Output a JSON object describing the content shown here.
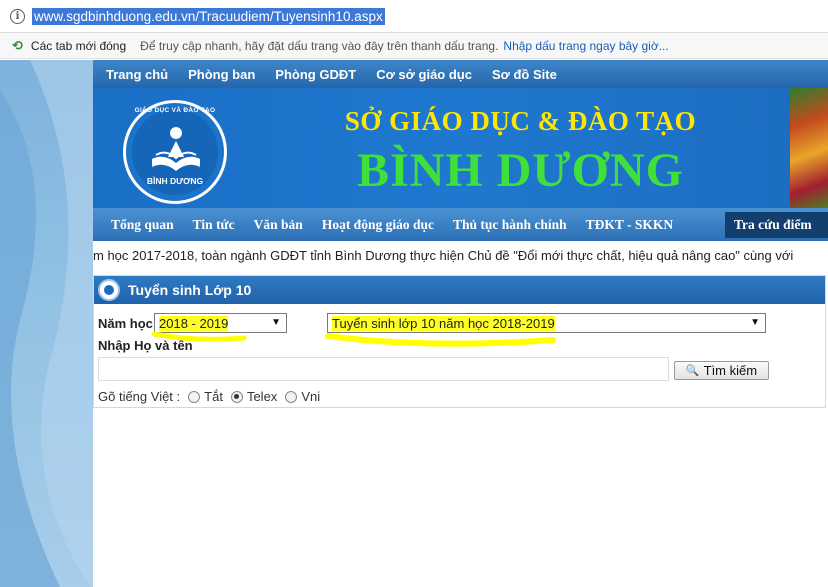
{
  "browser": {
    "url": "www.sgdbinhduong.edu.vn/Tracuudiem/Tuyensinh10.aspx",
    "bookmark_bar": {
      "recent_tabs": "Các tab mới đóng",
      "hint": "Để truy cập nhanh, hãy đặt dấu trang vào đây trên thanh dấu trang.",
      "link": "Nhập dấu trang ngay bây giờ..."
    }
  },
  "top_nav": [
    "Trang chủ",
    "Phòng ban",
    "Phòng GDĐT",
    "Cơ sở giáo dục",
    "Sơ đồ Site"
  ],
  "banner": {
    "logo_arc": "GIÁO DỤC VÀ ĐÀO TẠO",
    "logo_name": "BÌNH DƯƠNG",
    "title_line1": "SỞ GIÁO DỤC & ĐÀO TẠO",
    "title_line2": "BÌNH DƯƠNG"
  },
  "main_nav": {
    "items": [
      "Tổng quan",
      "Tin tức",
      "Văn bản",
      "Hoạt động giáo dục",
      "Thủ tục hành chính",
      "TĐKT - SKKN"
    ],
    "active": "Tra cứu điểm"
  },
  "ticker": "m học 2017-2018, toàn ngành GDĐT tỉnh Bình Dương thực hiện Chủ đề \"Đổi mới thực chất, hiệu quả nâng cao\" cùng với",
  "panel": {
    "title": "Tuyển sinh Lớp 10",
    "year_label": "Năm học",
    "year_value": "2018 - 2019",
    "exam_value": "Tuyển sinh lớp 10 năm học 2018-2019",
    "name_label": "Nhập Họ và tên",
    "name_value": "",
    "search_button": "Tìm kiếm",
    "typing_label": "Gõ tiếng Việt :",
    "typing_options": [
      "Tắt",
      "Telex",
      "Vni"
    ],
    "typing_selected": "Telex"
  },
  "colors": {
    "nav_blue": "#2c6fb6",
    "banner_blue": "#1a6fc6",
    "title_yellow": "#ffe600",
    "title_green": "#3fe03a",
    "highlight": "#ffff00"
  }
}
